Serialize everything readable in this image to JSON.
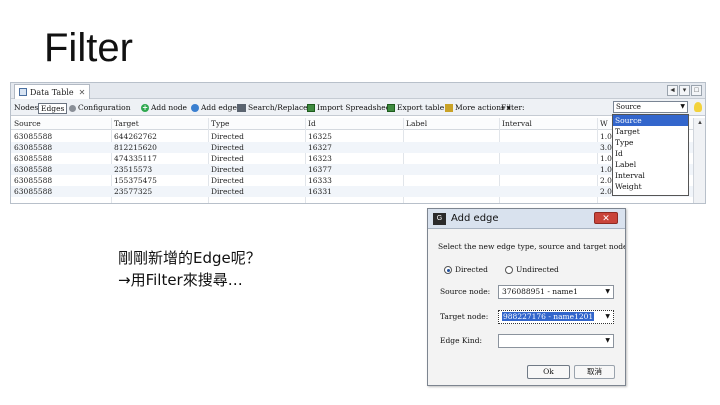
{
  "slide": {
    "title": "Filter"
  },
  "caption": {
    "line1": "剛剛新增的Edge呢？",
    "line2": "→用Filter來搜尋…"
  },
  "data_table": {
    "tab_label": "Data Table",
    "window_buttons": [
      "◄",
      "▾",
      "□"
    ],
    "toolbar": {
      "nodes": "Nodes",
      "edges": "Edges",
      "configuration": "Configuration",
      "add_node": "Add node",
      "add_edge": "Add edge",
      "search_replace": "Search/Replace",
      "import_spreadsheet": "Import Spreadsheet",
      "export_table": "Export table",
      "more_actions": "More actions",
      "filter": "Filter:",
      "filter_column": "Source"
    },
    "columns": [
      "Source",
      "Target",
      "Type",
      "Id",
      "Label",
      "Interval",
      "W"
    ],
    "rows": [
      [
        "63085588",
        "644262762",
        "Directed",
        "16325",
        "",
        "",
        "1.0"
      ],
      [
        "63085588",
        "812215620",
        "Directed",
        "16327",
        "",
        "",
        "3.0"
      ],
      [
        "63085588",
        "474335117",
        "Directed",
        "16323",
        "",
        "",
        "1.0"
      ],
      [
        "63085588",
        "23515573",
        "Directed",
        "16377",
        "",
        "",
        "1.0"
      ],
      [
        "63085588",
        "155375475",
        "Directed",
        "16333",
        "",
        "",
        "2.0"
      ],
      [
        "63085588",
        "23577325",
        "Directed",
        "16331",
        "",
        "",
        "2.0"
      ]
    ],
    "dropdown_options": [
      "Source",
      "Target",
      "Type",
      "Id",
      "Label",
      "Interval",
      "Weight"
    ],
    "dropdown_selected": "Source"
  },
  "dialog": {
    "title": "Add edge",
    "close": "✕",
    "instructions": "Select the new edge type, source and target nodes:",
    "directed_label": "Directed",
    "undirected_label": "Undirected",
    "source_label": "Source node:",
    "source_value": "376088951 - name1",
    "target_label": "Target node:",
    "target_value": "988227176 - name1201",
    "edge_kind_label": "Edge Kind:",
    "edge_kind_value": "",
    "ok": "Ok",
    "cancel": "取消"
  }
}
